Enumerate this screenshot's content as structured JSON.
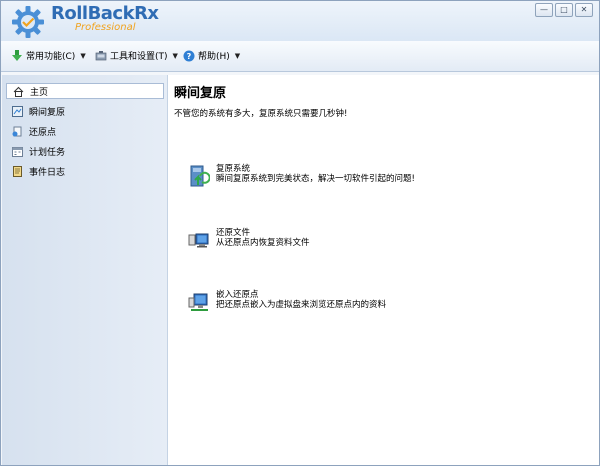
{
  "app": {
    "brand_main": "RollBackRx",
    "brand_sub": "Professional",
    "window_buttons": [
      "—",
      "□",
      "✕"
    ]
  },
  "menubar": {
    "items": [
      {
        "label": "常用功能(C)",
        "icon": "download-icon"
      },
      {
        "label": "工具和设置(T)",
        "icon": "tools-icon"
      },
      {
        "label": "帮助(H)",
        "icon": "help-icon"
      }
    ]
  },
  "sidebar": {
    "items": [
      {
        "label": "主页",
        "icon": "home-icon"
      },
      {
        "label": "瞬间复原",
        "icon": "restore-icon"
      },
      {
        "label": "还原点",
        "icon": "snapshot-icon"
      },
      {
        "label": "计划任务",
        "icon": "schedule-icon"
      },
      {
        "label": "事件日志",
        "icon": "log-icon"
      }
    ]
  },
  "main": {
    "title": "瞬间复原",
    "subtitle": "不管您的系统有多大，复原系统只需要几秒钟!",
    "actions": [
      {
        "title": "复原系统",
        "desc": "瞬间复原系统到完美状态，解决一切软件引起的问题!",
        "icon": "system-restore-icon"
      },
      {
        "title": "还原文件",
        "desc": "从还原点内恢复资料文件",
        "icon": "file-restore-icon"
      },
      {
        "title": "嵌入还原点",
        "desc": "把还原点嵌入为虚拟盘来浏览还原点内的资料",
        "icon": "mount-snapshot-icon"
      }
    ]
  }
}
